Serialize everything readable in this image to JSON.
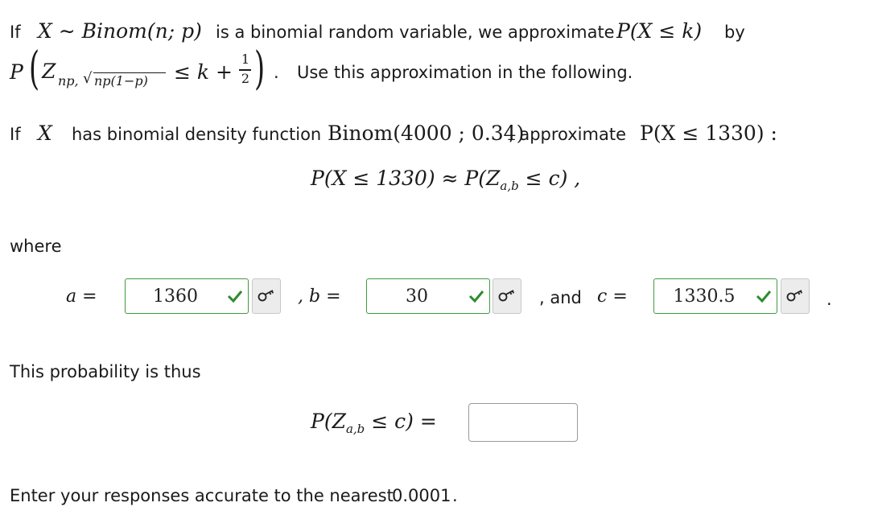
{
  "line1": {
    "if": "If",
    "dist": "X ∼ Binom(n; p)",
    "text": "is a binomial random variable, we approximate",
    "prob": "P(X ≤ k)",
    "by": "by"
  },
  "line2": {
    "P": "P",
    "Z": "Z",
    "sub_np": "np,",
    "sub_sqrt": "np(1−p)",
    "le_k": "≤ k +",
    "half_num": "1",
    "half_den": "2",
    "dot": ".",
    "text": "Use this approximation in the following."
  },
  "line3": {
    "if": "If",
    "X": "X",
    "text1": "has binomial density function",
    "dist": "Binom(4000 ; 0.34)",
    "text2": ", approximate",
    "prob": "P(X ≤ 1330) :"
  },
  "display1": {
    "left": "P(X ≤ 1330) ≈ P(Z",
    "sub": "a,b",
    "right": "≤ c) ,"
  },
  "where": "where",
  "inputs": {
    "a_label": "a =",
    "a_value": "1360",
    "b_label": ", b =",
    "b_value": "30",
    "and_label": ", and",
    "c_label": "c =",
    "c_value": "1330.5",
    "end_dot": "."
  },
  "thus": "This probability is thus",
  "display2": {
    "left": "P(Z",
    "sub": "a,b",
    "right": "≤ c) ="
  },
  "footer": {
    "text": "Enter your responses accurate to the nearest",
    "precision": "0.0001",
    "dot": "."
  },
  "colors": {
    "correct": "#3f9b3f",
    "key_bg": "#ececec"
  },
  "icons": [
    "check-icon",
    "key-icon"
  ]
}
